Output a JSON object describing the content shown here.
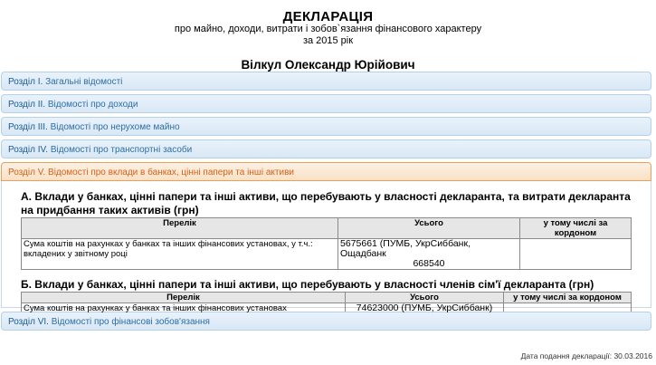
{
  "header": {
    "title": "ДЕКЛАРАЦІЯ",
    "subtitle": "про майно, доходи, витрати і зобов`язання фінансового характеру",
    "year": "за 2015 рік",
    "person": "Вілкул Олександр Юрійович"
  },
  "sections": [
    {
      "num": "Розділ I.",
      "title": "Загальні відомості"
    },
    {
      "num": "Розділ II.",
      "title": "Відомості про доходи"
    },
    {
      "num": "Розділ III.",
      "title": "Відомості про нерухоме майно"
    },
    {
      "num": "Розділ IV.",
      "title": "Відомості про транспортні засоби"
    }
  ],
  "open_section": {
    "label": "Розділ V. Відомості про вклади в банках, цінні папери та інші активи",
    "part_a": {
      "title": "А. Вклади у банках, цінні папери та інші активи, що перебувають у власності декларанта, та витрати декларанта на придбання таких активів (грн)",
      "headers": [
        "Перелік",
        "Усього",
        "у тому числі за кордоном"
      ],
      "row_name": "Сума коштів на рахунках у банках та інших фінансових установах, у т.ч.: вкладених у звітному році",
      "row_total": "5675661 (ПУМБ, УкрСиббанк, Ощадбанк",
      "row_total2": "668540",
      "row_abroad": ""
    },
    "part_b": {
      "title": "Б. Вклади у банках, цінні папери та інші активи, що перебувають у власності членів сім'ї декларанта (грн)",
      "headers": [
        "Перелік",
        "Усього",
        "у тому числі за кордоном"
      ],
      "row_name": "Сума коштів на рахунках у банках та інших фінансових установах",
      "row_total": "74623000 (ПУМБ, УкрСиббанк)",
      "row_abroad": ""
    }
  },
  "last_section": {
    "num": "Розділ VI.",
    "title": "Відомості про фінансові зобов'язання"
  },
  "footer": "Дата подання декларації: 30.03.2016"
}
